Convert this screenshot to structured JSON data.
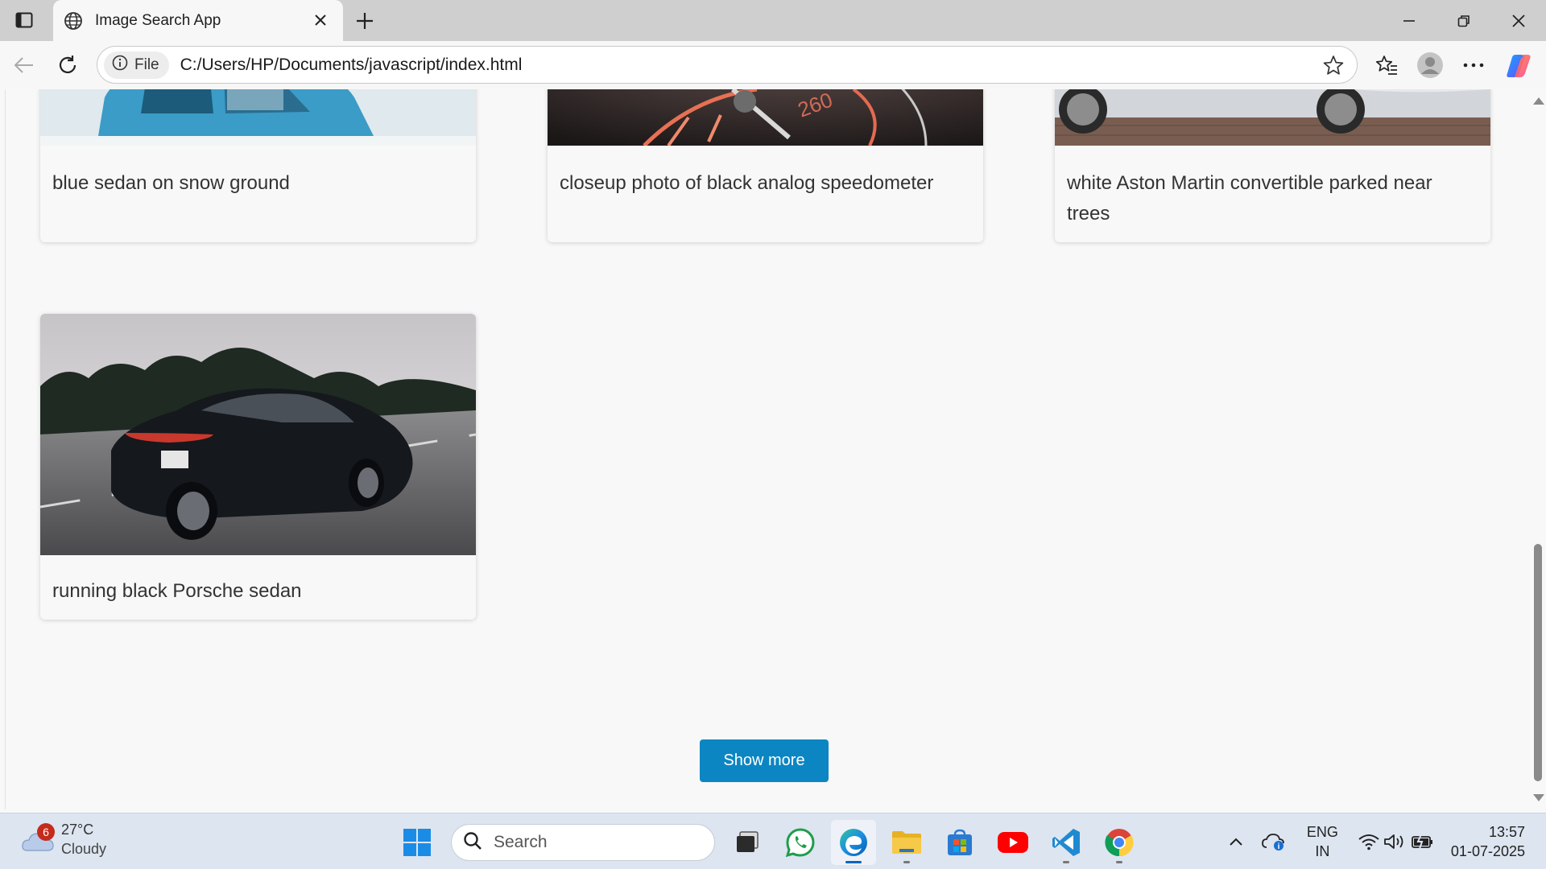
{
  "browser": {
    "tab": {
      "title": "Image Search App"
    },
    "addressbar": {
      "site_label": "File",
      "url": "C:/Users/HP/Documents/javascript/index.html"
    }
  },
  "page": {
    "cards": [
      {
        "caption": "blue sedan on snow ground"
      },
      {
        "caption": "closeup photo of black analog speedometer"
      },
      {
        "caption": "white Aston Martin convertible parked near trees"
      },
      {
        "caption": "running black Porsche sedan"
      }
    ],
    "show_more_label": "Show more",
    "accent_color": "#0c86c2"
  },
  "taskbar": {
    "weather": {
      "badge": "6",
      "temperature": "27°C",
      "condition": "Cloudy"
    },
    "search_placeholder": "Search",
    "language": {
      "line1": "ENG",
      "line2": "IN"
    },
    "clock": {
      "time": "13:57",
      "date": "01-07-2025"
    }
  }
}
